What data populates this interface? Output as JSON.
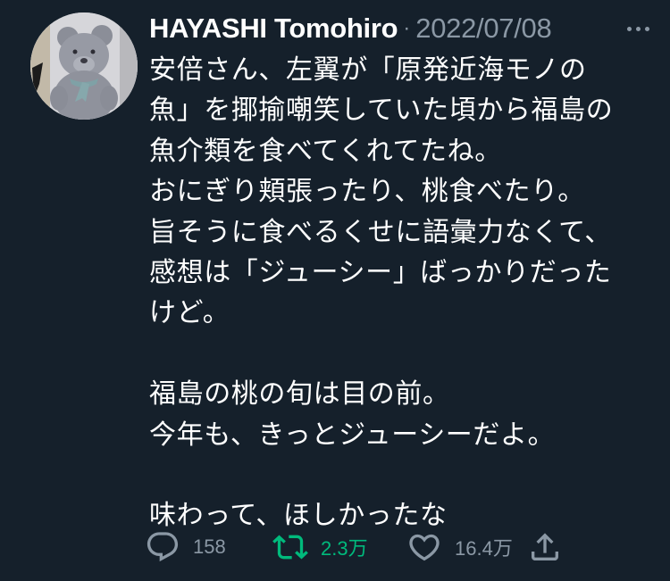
{
  "tweet": {
    "display_name": "HAYASHI Tomohiro",
    "separator": "·",
    "timestamp": "2022/07/08",
    "more_icon": "more-horizontal-icon",
    "lines": [
      "安倍さん、左翼が「原発近海モノの",
      "魚」を揶揄嘲笑していた頃から福島の",
      "魚介類を食べてくれてたね。",
      "おにぎり頬張ったり、桃食べたり。",
      "旨そうに食べるくせに語彙力なくて、",
      "感想は「ジューシー」ばっかりだった",
      "けど。",
      "",
      "福島の桃の旬は目の前。",
      "今年も、きっとジューシーだよ。",
      "",
      "味わって、ほしかったな"
    ]
  },
  "actions": {
    "reply": {
      "icon": "reply-icon",
      "count": "158"
    },
    "retweet": {
      "icon": "retweet-icon",
      "count": "2.3万",
      "color": "#00ba7c"
    },
    "like": {
      "icon": "heart-icon",
      "count": "16.4万"
    },
    "share": {
      "icon": "share-icon"
    }
  },
  "colors": {
    "background": "#15202b",
    "text": "#ffffff",
    "muted": "#8b98a5",
    "retweet_active": "#00ba7c"
  }
}
